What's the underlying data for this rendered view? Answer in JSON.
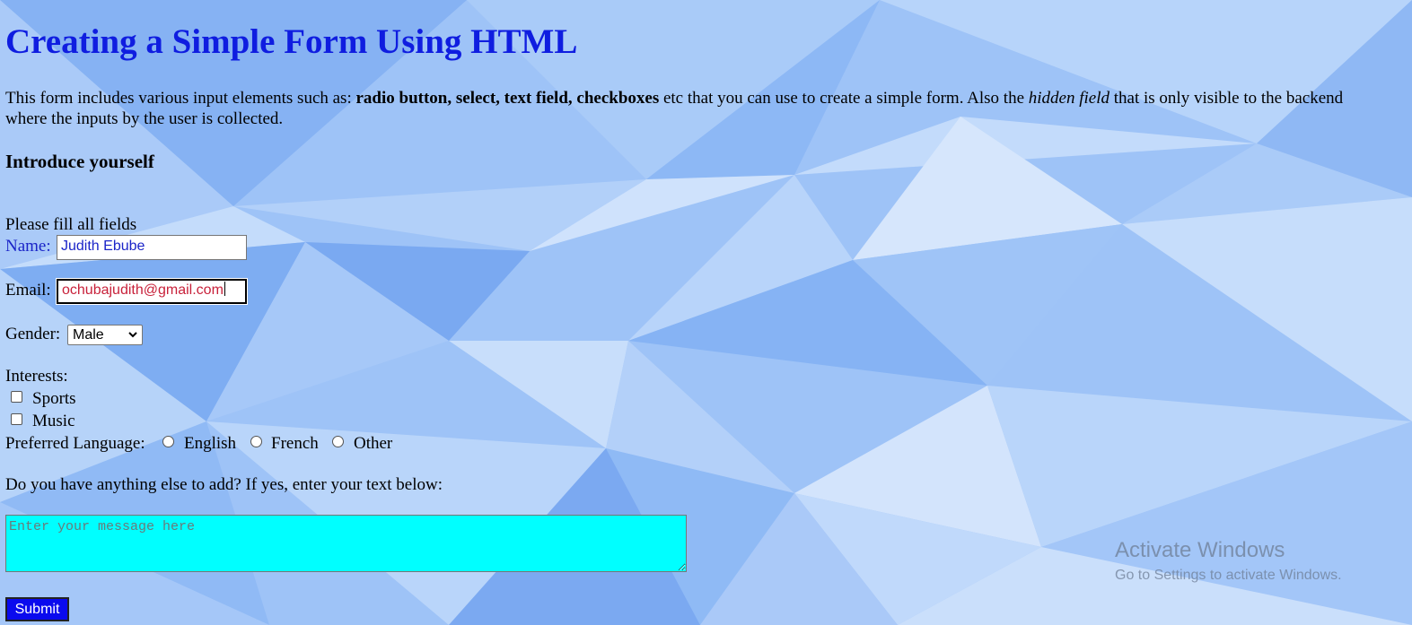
{
  "page": {
    "title": "Creating a Simple Form Using HTML",
    "intro": {
      "part1": "This form includes various input elements such as: ",
      "bold": "radio button, select, text field, checkboxes",
      "part2": " etc that you can use to create a simple form. Also the ",
      "italic": "hidden field",
      "part3": " that is only visible to the backend where the inputs by the user is collected."
    },
    "section_heading": "Introduce yourself"
  },
  "form": {
    "instructions": "Please fill all fields",
    "name_label": "Name:",
    "name_value": "Judith Ebube",
    "email_label": "Email:",
    "email_value": "ochubajudith@gmail.com",
    "gender_label": "Gender:",
    "gender_selected": "Male",
    "interests_label": "Interests:",
    "interests": [
      {
        "label": "Sports",
        "checked": false
      },
      {
        "label": "Music",
        "checked": false
      }
    ],
    "language_label": "Preferred Language:",
    "languages": [
      {
        "label": "English",
        "checked": false
      },
      {
        "label": "French",
        "checked": false
      },
      {
        "label": "Other",
        "checked": false
      }
    ],
    "message_prompt": "Do you have anything else to add? If yes, enter your text below:",
    "message_placeholder": "Enter your message here",
    "submit_label": "Submit"
  },
  "watermark": {
    "line1": "Activate Windows",
    "line2": "Go to Settings to activate Windows."
  },
  "colors": {
    "title": "#0f1de0",
    "name_text": "#1a24c8",
    "email_text": "#c8213a",
    "textarea_bg": "#00ffff",
    "submit_bg": "#0a0aee"
  }
}
